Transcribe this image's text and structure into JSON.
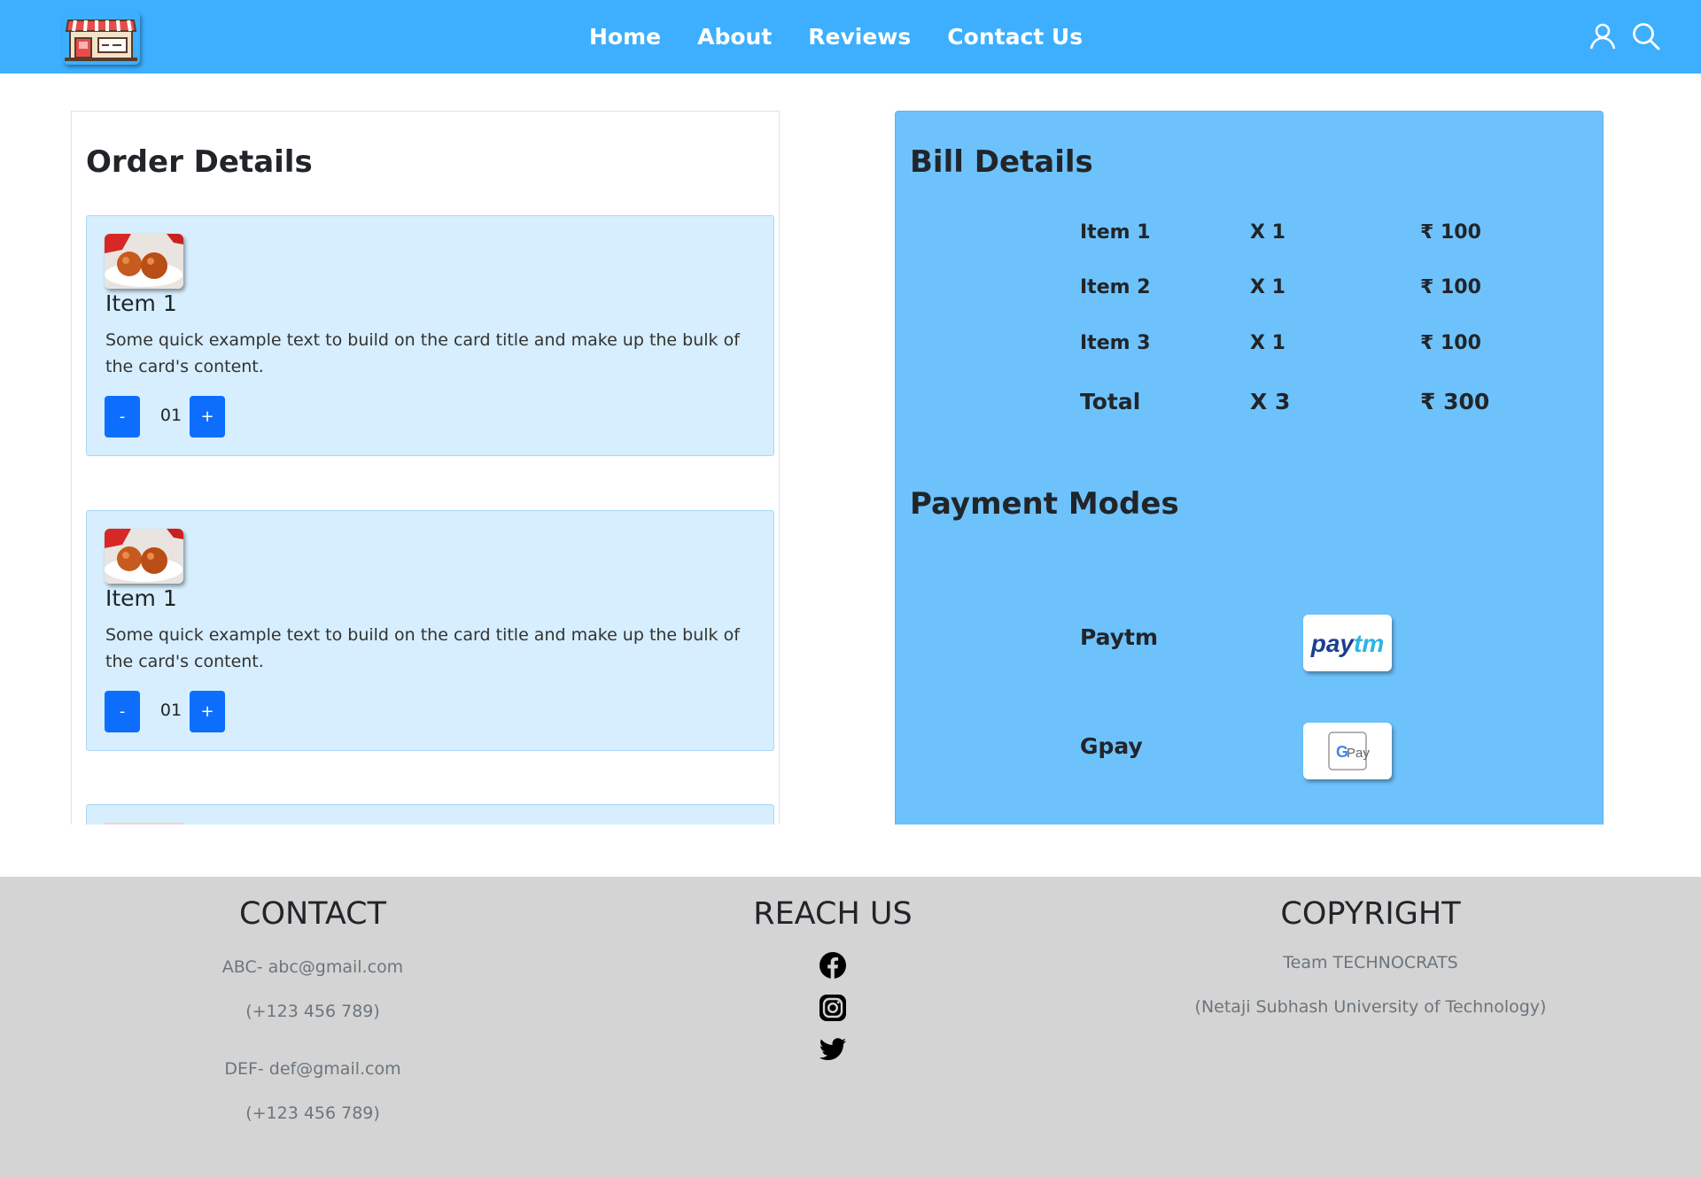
{
  "nav": {
    "links": [
      "Home",
      "About",
      "Reviews",
      "Contact Us"
    ],
    "icons": [
      "user-icon",
      "search-icon"
    ]
  },
  "order": {
    "title": "Order Details",
    "items": [
      {
        "title": "Item 1",
        "text": "Some quick example text to build on the card title and make up the bulk of the card's content.",
        "qty": "01",
        "minus_label": "-",
        "plus_label": "+"
      },
      {
        "title": "Item 1",
        "text": "Some quick example text to build on the card title and make up the bulk of the card's content.",
        "qty": "01",
        "minus_label": "-",
        "plus_label": "+"
      }
    ]
  },
  "bill": {
    "title": "Bill Details",
    "rows": [
      {
        "item": "Item 1",
        "qty": "X 1",
        "price": "₹ 100"
      },
      {
        "item": "Item 2",
        "qty": "X 1",
        "price": "₹ 100"
      },
      {
        "item": "Item 3",
        "qty": "X 1",
        "price": "₹ 100"
      }
    ],
    "total": {
      "item": "Total",
      "qty": "X 3",
      "price": "₹ 300"
    }
  },
  "payment": {
    "title": "Payment Modes",
    "modes": [
      {
        "label": "Paytm",
        "logo_text": "Paytm"
      },
      {
        "label": "Gpay",
        "logo_text": "G Pay"
      }
    ]
  },
  "footer": {
    "contact": {
      "title": "CONTACT",
      "lines": [
        "ABC- abc@gmail.com",
        "(+123 456 789)",
        "DEF- def@gmail.com",
        "(+123 456 789)"
      ]
    },
    "reach": {
      "title": "REACH US",
      "icons": [
        "facebook-icon",
        "instagram-icon",
        "twitter-icon"
      ]
    },
    "copyright": {
      "title": "COPYRIGHT",
      "lines": [
        "Team TECHNOCRATS",
        "(Netaji Subhash University of Technology)"
      ]
    }
  },
  "colors": {
    "navbar": "#3daffe",
    "bill_panel": "#6ec2fc",
    "card": "#d6eefd",
    "button": "#0d6efd",
    "footer": "#d4d4d4"
  }
}
